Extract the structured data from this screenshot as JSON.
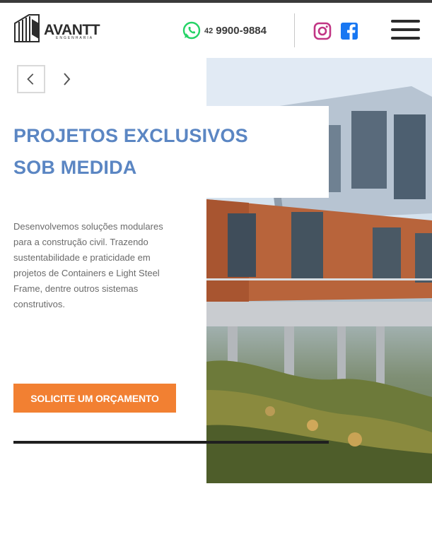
{
  "brand": {
    "name": "AVANTT",
    "tagline": "ENGENHARIA"
  },
  "header": {
    "phone_ddd": "42",
    "phone_number": "9900-9884",
    "whatsapp_icon": "whatsapp-icon",
    "instagram_icon": "instagram-icon",
    "facebook_icon": "facebook-icon",
    "menu_icon": "hamburger-menu-icon"
  },
  "slider": {
    "prev_icon": "chevron-left-icon",
    "next_icon": "chevron-right-icon"
  },
  "hero": {
    "title_line1": "PROJETOS EXCLUSIVOS",
    "title_line2": "SOB MEDIDA",
    "description": "Desenvolvemos soluções modulares para a construção civil. Trazendo sustentabilidade e praticidade em projetos de Containers e Light Steel Frame, dentre outros sistemas construtivos.",
    "cta_label": "SOLICITE UM ORÇAMENTO"
  },
  "colors": {
    "accent_blue": "#5b86c3",
    "cta_orange": "#f28032",
    "whatsapp_green": "#25d366",
    "instagram_pink": "#c13584",
    "facebook_blue": "#1877f2",
    "text_dark": "#3a3a3a"
  }
}
